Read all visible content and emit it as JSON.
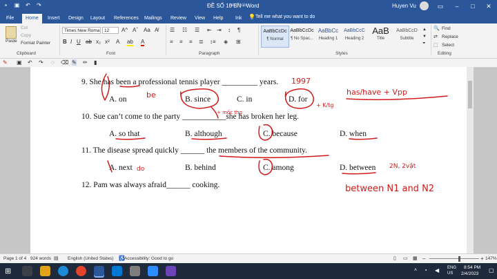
{
  "window": {
    "title": "ĐỀ SỐ 10 BN  -  Word",
    "context_tab": "Ink Tools",
    "user": "Huyen Vu"
  },
  "tabs": [
    "File",
    "Home",
    "Insert",
    "Design",
    "Layout",
    "References",
    "Mailings",
    "Review",
    "View",
    "Help",
    "Ink"
  ],
  "tell_me": "Tell me what you want to do",
  "clipboard": {
    "paste": "Paste",
    "cut": "Cut",
    "copy": "Copy",
    "format_painter": "Format Painter",
    "label": "Clipboard"
  },
  "font": {
    "name": "Times New Roma",
    "size": "12",
    "label": "Font"
  },
  "paragraph": {
    "label": "Paragraph"
  },
  "styles": {
    "label": "Styles",
    "items": [
      {
        "preview": "AaBbCcDc",
        "name": "¶ Normal"
      },
      {
        "preview": "AaBbCcDc",
        "name": "¶ No Spac..."
      },
      {
        "preview": "AaBbCc",
        "name": "Heading 1"
      },
      {
        "preview": "AaBbCcC",
        "name": "Heading 2"
      },
      {
        "preview": "AaB",
        "name": "Title"
      },
      {
        "preview": "AaBbCcD",
        "name": "Subtitle"
      }
    ]
  },
  "editing": {
    "find": "Find",
    "replace": "Replace",
    "select": "Select",
    "label": "Editing"
  },
  "document": {
    "q9": "9. She has been a professional tennis player _________ years.",
    "q9_options": [
      "A. on",
      "B. since",
      "C. in",
      "D. for"
    ],
    "q10": "10. Sue can’t come to the party ___________she has broken her leg.",
    "q10_options": [
      "A. so that",
      "B. although",
      "C. because",
      "D. when"
    ],
    "q11": "11.  The disease spread quickly ______ the members of the community.",
    "q11_options": [
      "A. next",
      "B. behind",
      "C. among",
      "D. between"
    ],
    "q12": "12. Pam was always afraid______ cooking."
  },
  "ink": {
    "note_1997": "1997",
    "note_be": "be",
    "note_rule_d": "has/have + Vpp",
    "note_since": "+ mốc thg",
    "note_for": "+ K/tg",
    "note_do": "do",
    "note_between_count": "2N, 2vật",
    "note_between": "between N1 and N2"
  },
  "status": {
    "page": "Page 1 of 4",
    "words": "924 words",
    "language": "English (United States)",
    "accessibility": "Accessibility: Good to go",
    "zoom": "147%"
  },
  "taskbar": {
    "lang1": "ENG",
    "lang2": "US",
    "time": "8:54 PM",
    "date": "2/4/2023"
  },
  "colors": {
    "word_blue": "#2b579a",
    "ink_red": "#d11a1a"
  }
}
